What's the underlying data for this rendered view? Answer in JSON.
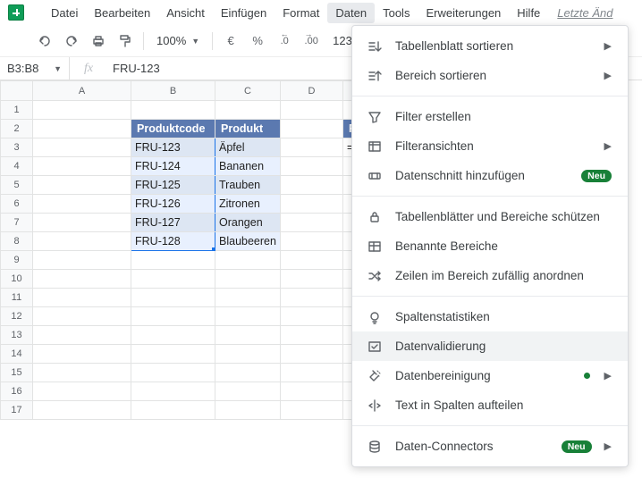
{
  "menubar": {
    "items": [
      "Datei",
      "Bearbeiten",
      "Ansicht",
      "Einfügen",
      "Format",
      "Daten",
      "Tools",
      "Erweiterungen",
      "Hilfe"
    ],
    "active_index": 5,
    "last_edit": "Letzte Änd"
  },
  "toolbar": {
    "zoom": "100%",
    "currency": "€",
    "percent": "%",
    "dec_dec": ".0",
    "inc_dec": ".00",
    "more_fmt": "123"
  },
  "namebox": "B3:B8",
  "fx_label": "fx",
  "fx_value": "FRU-123",
  "columns": [
    "A",
    "B",
    "C",
    "D"
  ],
  "rows": [
    "1",
    "2",
    "3",
    "4",
    "5",
    "6",
    "7",
    "8",
    "9",
    "10",
    "11",
    "12",
    "13",
    "14",
    "15",
    "16",
    "17"
  ],
  "table": {
    "headers": {
      "b": "Produktcode",
      "c": "Produkt",
      "e": "Formel"
    },
    "data": [
      {
        "code": "FRU-123",
        "prod": "Äpfel"
      },
      {
        "code": "FRU-124",
        "prod": "Bananen"
      },
      {
        "code": "FRU-125",
        "prod": "Trauben"
      },
      {
        "code": "FRU-126",
        "prod": "Zitronen"
      },
      {
        "code": "FRU-127",
        "prod": "Orangen"
      },
      {
        "code": "FRU-128",
        "prod": "Blaubeeren"
      }
    ],
    "formula_cell": "=IDENTISCH"
  },
  "dropdown": {
    "groups": [
      [
        {
          "icon": "sort-sheet",
          "label": "Tabellenblatt sortieren",
          "submenu": true
        },
        {
          "icon": "sort-range",
          "label": "Bereich sortieren",
          "submenu": true
        }
      ],
      [
        {
          "icon": "filter",
          "label": "Filter erstellen"
        },
        {
          "icon": "filter-views",
          "label": "Filteransichten",
          "submenu": true
        },
        {
          "icon": "slicer",
          "label": "Datenschnitt hinzufügen",
          "badge": "Neu"
        }
      ],
      [
        {
          "icon": "lock",
          "label": "Tabellenblätter und Bereiche schützen"
        },
        {
          "icon": "named",
          "label": "Benannte Bereiche"
        },
        {
          "icon": "shuffle",
          "label": "Zeilen im Bereich zufällig anordnen"
        }
      ],
      [
        {
          "icon": "bulb",
          "label": "Spaltenstatistiken"
        },
        {
          "icon": "validate",
          "label": "Datenvalidierung",
          "highlight": true
        },
        {
          "icon": "clean",
          "label": "Datenbereinigung",
          "dot": true,
          "submenu": true
        },
        {
          "icon": "split",
          "label": "Text in Spalten aufteilen"
        }
      ],
      [
        {
          "icon": "db",
          "label": "Daten-Connectors",
          "badge": "Neu",
          "submenu": true
        }
      ]
    ]
  }
}
